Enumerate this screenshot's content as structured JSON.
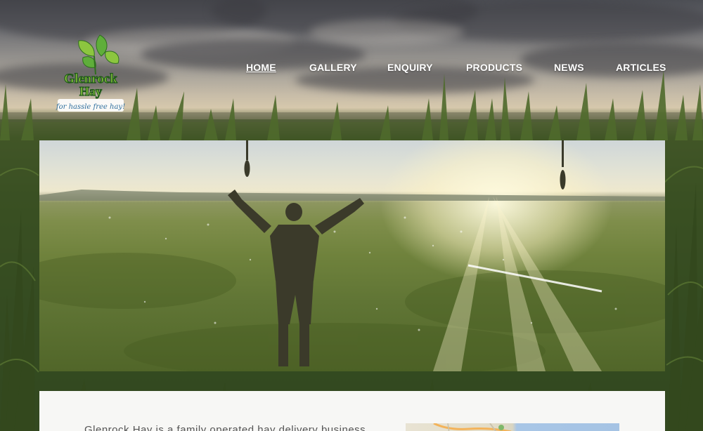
{
  "site": {
    "brand_name_line1": "Glenrock",
    "brand_name_line2": "Hay",
    "tagline": "for hassle free hay!"
  },
  "nav": {
    "items": [
      {
        "label": "HOME",
        "active": true
      },
      {
        "label": "GALLERY",
        "active": false
      },
      {
        "label": "ENQUIRY",
        "active": false
      },
      {
        "label": "PRODUCTS",
        "active": false
      },
      {
        "label": "NEWS",
        "active": false
      },
      {
        "label": "ARTICLES",
        "active": false
      }
    ]
  },
  "content": {
    "intro_text": "Glenrock Hay is a family operated hay delivery business"
  },
  "colors": {
    "brand_green": "#3a8f2e",
    "brand_light_green": "#8cc63f",
    "nav_text": "#ffffff",
    "body_text": "#555555",
    "card_bg": "#f7f7f5"
  }
}
